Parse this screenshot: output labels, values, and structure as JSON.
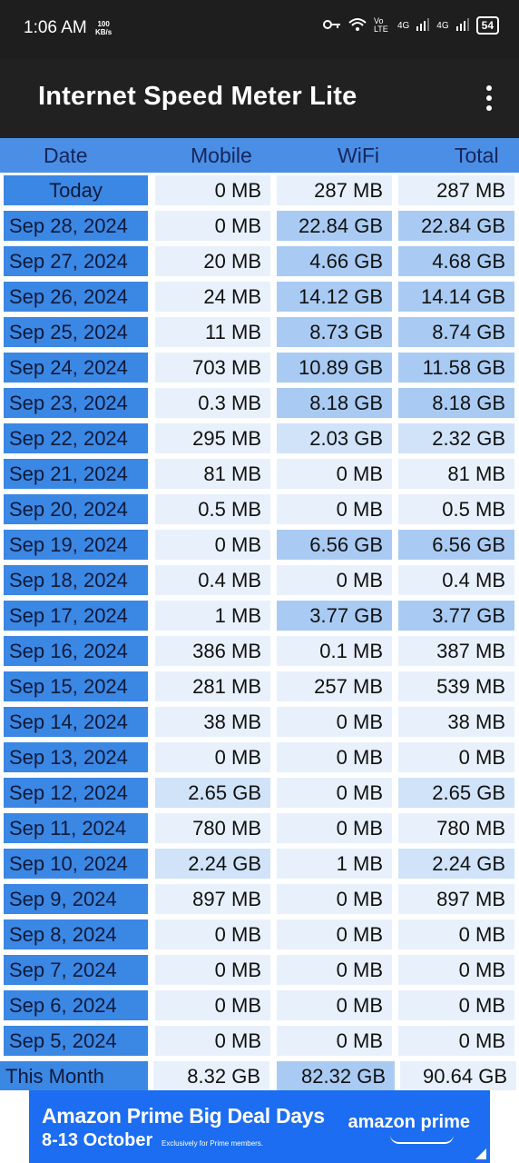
{
  "status": {
    "time": "1:06 AM",
    "speed_value": "100",
    "speed_unit": "KB/s",
    "volte": "Vo LTE",
    "net1": "4G",
    "net2": "4G",
    "battery": "54"
  },
  "app": {
    "title": "Internet Speed Meter Lite"
  },
  "columns": [
    "Date",
    "Mobile",
    "WiFi",
    "Total"
  ],
  "rows": [
    {
      "date": "Today",
      "mobile": "0 MB",
      "wifi": "287 MB",
      "total": "287 MB"
    },
    {
      "date": "Sep 28, 2024",
      "mobile": "0 MB",
      "wifi": "22.84 GB",
      "total": "22.84 GB"
    },
    {
      "date": "Sep 27, 2024",
      "mobile": "20 MB",
      "wifi": "4.66 GB",
      "total": "4.68 GB"
    },
    {
      "date": "Sep 26, 2024",
      "mobile": "24 MB",
      "wifi": "14.12 GB",
      "total": "14.14 GB"
    },
    {
      "date": "Sep 25, 2024",
      "mobile": "11 MB",
      "wifi": "8.73 GB",
      "total": "8.74 GB"
    },
    {
      "date": "Sep 24, 2024",
      "mobile": "703 MB",
      "wifi": "10.89 GB",
      "total": "11.58 GB"
    },
    {
      "date": "Sep 23, 2024",
      "mobile": "0.3 MB",
      "wifi": "8.18 GB",
      "total": "8.18 GB"
    },
    {
      "date": "Sep 22, 2024",
      "mobile": "295 MB",
      "wifi": "2.03 GB",
      "total": "2.32 GB"
    },
    {
      "date": "Sep 21, 2024",
      "mobile": "81 MB",
      "wifi": "0 MB",
      "total": "81 MB"
    },
    {
      "date": "Sep 20, 2024",
      "mobile": "0.5 MB",
      "wifi": "0 MB",
      "total": "0.5 MB"
    },
    {
      "date": "Sep 19, 2024",
      "mobile": "0 MB",
      "wifi": "6.56 GB",
      "total": "6.56 GB"
    },
    {
      "date": "Sep 18, 2024",
      "mobile": "0.4 MB",
      "wifi": "0 MB",
      "total": "0.4 MB"
    },
    {
      "date": "Sep 17, 2024",
      "mobile": "1 MB",
      "wifi": "3.77 GB",
      "total": "3.77 GB"
    },
    {
      "date": "Sep 16, 2024",
      "mobile": "386 MB",
      "wifi": "0.1 MB",
      "total": "387 MB"
    },
    {
      "date": "Sep 15, 2024",
      "mobile": "281 MB",
      "wifi": "257 MB",
      "total": "539 MB"
    },
    {
      "date": "Sep 14, 2024",
      "mobile": "38 MB",
      "wifi": "0 MB",
      "total": "38 MB"
    },
    {
      "date": "Sep 13, 2024",
      "mobile": "0 MB",
      "wifi": "0 MB",
      "total": "0 MB"
    },
    {
      "date": "Sep 12, 2024",
      "mobile": "2.65 GB",
      "wifi": "0 MB",
      "total": "2.65 GB"
    },
    {
      "date": "Sep 11, 2024",
      "mobile": "780 MB",
      "wifi": "0 MB",
      "total": "780 MB"
    },
    {
      "date": "Sep 10, 2024",
      "mobile": "2.24 GB",
      "wifi": "1 MB",
      "total": "2.24 GB"
    },
    {
      "date": "Sep 9, 2024",
      "mobile": "897 MB",
      "wifi": "0 MB",
      "total": "897 MB"
    },
    {
      "date": "Sep 8, 2024",
      "mobile": "0 MB",
      "wifi": "0 MB",
      "total": "0 MB"
    },
    {
      "date": "Sep 7, 2024",
      "mobile": "0 MB",
      "wifi": "0 MB",
      "total": "0 MB"
    },
    {
      "date": "Sep 6, 2024",
      "mobile": "0 MB",
      "wifi": "0 MB",
      "total": "0 MB"
    },
    {
      "date": "Sep 5, 2024",
      "mobile": "0 MB",
      "wifi": "0 MB",
      "total": "0 MB"
    }
  ],
  "footer": {
    "label": "This Month",
    "mobile": "8.32 GB",
    "wifi": "82.32 GB",
    "total": "90.64 GB"
  },
  "ad": {
    "title": "Amazon Prime Big Deal Days",
    "dates": "8-13 October",
    "subtitle": "Exclusively for Prime members.",
    "brand": "amazon prime"
  },
  "colors": {
    "header": "#4a8ee6",
    "date_cell": "#3b87e4",
    "app_bar": "#212121",
    "ad_bg": "#1c6df1"
  }
}
